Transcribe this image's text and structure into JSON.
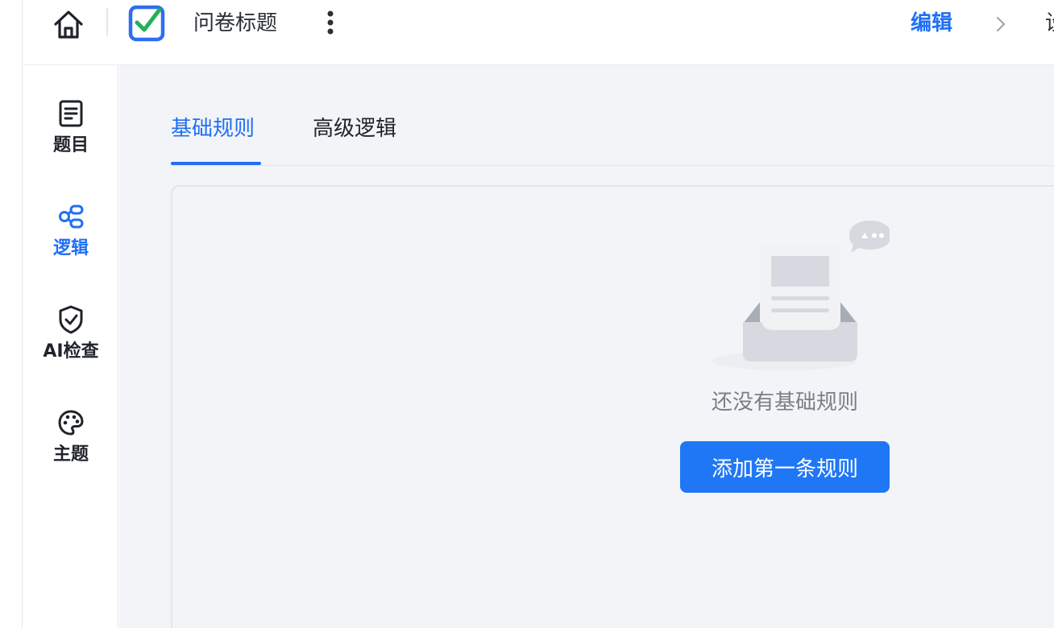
{
  "header": {
    "survey_title": "问卷标题",
    "steps": [
      {
        "label": "编辑",
        "active": true
      },
      {
        "label": "设"
      }
    ]
  },
  "sidebar": {
    "items": [
      {
        "label": "题目",
        "icon": "document-icon",
        "active": false
      },
      {
        "label": "逻辑",
        "icon": "logic-flow-icon",
        "active": true
      },
      {
        "label": "AI检查",
        "icon": "shield-check-icon",
        "active": false
      },
      {
        "label": "主题",
        "icon": "palette-icon",
        "active": false
      }
    ]
  },
  "main": {
    "tabs": [
      {
        "label": "基础规则",
        "active": true
      },
      {
        "label": "高级逻辑",
        "active": false
      }
    ],
    "empty_state": {
      "message": "还没有基础规则",
      "button_label": "添加第一条规则",
      "illustration": "empty-inbox-illustration"
    }
  },
  "colors": {
    "accent": "#1f6ff5",
    "button": "#1f77f6",
    "background": "#f3f4f8",
    "muted_text": "#7a7f87"
  }
}
